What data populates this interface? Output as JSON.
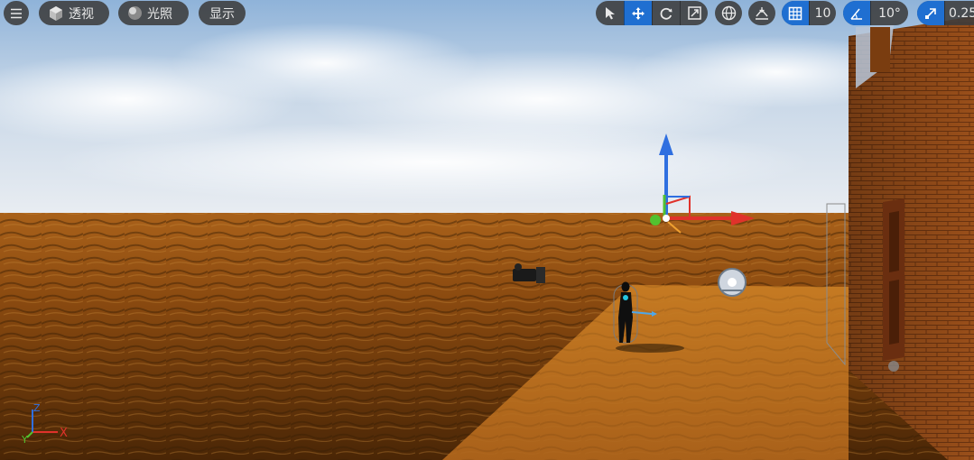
{
  "toolbar_left": {
    "menu_icon": "hamburger-icon",
    "view_mode": {
      "icon": "cube-icon",
      "label": "透视"
    },
    "lighting": {
      "icon": "sphere-icon",
      "label": "光照"
    },
    "show": {
      "label": "显示"
    }
  },
  "toolbar_right": {
    "transform_tools": [
      {
        "name": "select-tool",
        "icon": "cursor-icon",
        "active": false
      },
      {
        "name": "translate-tool",
        "icon": "move-arrows-icon",
        "active": true
      },
      {
        "name": "rotate-tool",
        "icon": "rotate-icon",
        "active": false
      },
      {
        "name": "scale-tool",
        "icon": "scale-icon",
        "active": false
      }
    ],
    "world_local_icon": "globe-icon",
    "surface_snap_icon": "surface-snap-icon",
    "grid_snap": {
      "icon": "grid-icon",
      "value": "10",
      "active": true
    },
    "rotation_snap": {
      "icon": "angle-icon",
      "value": "10°",
      "active": true
    },
    "scale_snap": {
      "icon": "scale-snap-icon",
      "value": "0.25",
      "active": true
    }
  },
  "axis_indicator": {
    "x_label": "X",
    "y_label": "Y",
    "z_label": "Z"
  },
  "colors": {
    "accent": "#1f6fd1",
    "toolbar_bg": "#3c3c3c",
    "ground": "#b56a1c",
    "sky_top": "#8fb3d9",
    "axis_x": "#e0322b",
    "axis_y": "#52c22f",
    "axis_z": "#2f6fe0"
  }
}
